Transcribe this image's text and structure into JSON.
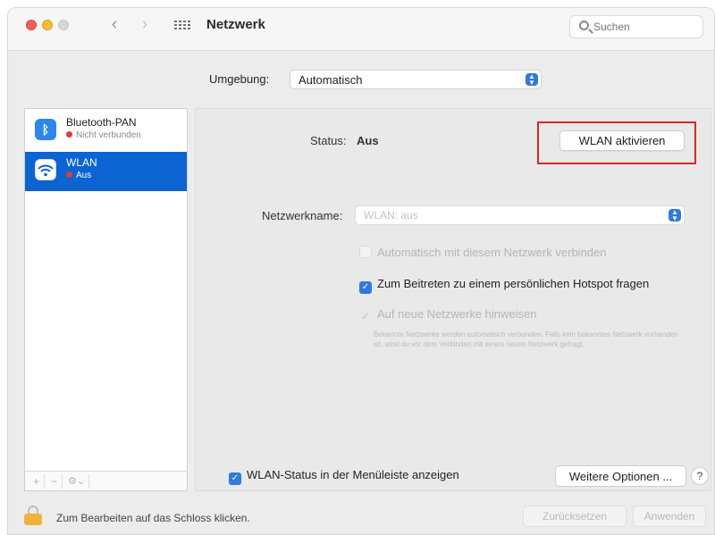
{
  "window": {
    "title": "Netzwerk",
    "search_placeholder": "Suchen"
  },
  "location": {
    "label": "Umgebung:",
    "value": "Automatisch"
  },
  "services": [
    {
      "name": "Bluetooth-PAN",
      "status": "Nicht verbunden",
      "icon": "bluetooth-icon",
      "status_color": "#e03c31"
    },
    {
      "name": "WLAN",
      "status": "Aus",
      "icon": "wifi-icon",
      "status_color": "#e03c31",
      "selected": true
    }
  ],
  "sidebar_footer": {
    "add": "+",
    "remove": "−",
    "action": "⚙︎⌄"
  },
  "detail": {
    "status_label": "Status:",
    "status_value": "Aus",
    "enable_button": "WLAN aktivieren",
    "network_name_label": "Netzwerkname:",
    "network_name_value": "WLAN: aus",
    "auto_join": "Automatisch mit diesem Netzwerk verbinden",
    "hotspot": "Zum Beitreten zu einem persönlichen Hotspot fragen",
    "ask_new": "Auf neue Netzwerke hinweisen",
    "help_text": "Bekannte Netzwerke werden automatisch verbunden. Falls kein bekanntes Netzwerk vorhanden ist, wirst du vor dem Verbinden mit einem neuen Netzwerk gefragt.",
    "menubar_status": "WLAN-Status in der Menüleiste anzeigen",
    "more_options": "Weitere Optionen ...",
    "help": "?"
  },
  "footer": {
    "lock_text": "Zum Bearbeiten auf das Schloss klicken.",
    "revert": "Zurücksetzen",
    "apply": "Anwenden"
  },
  "colors": {
    "accent": "#2e7ae0",
    "selection": "#0b64d2",
    "highlight": "#e0261f"
  }
}
